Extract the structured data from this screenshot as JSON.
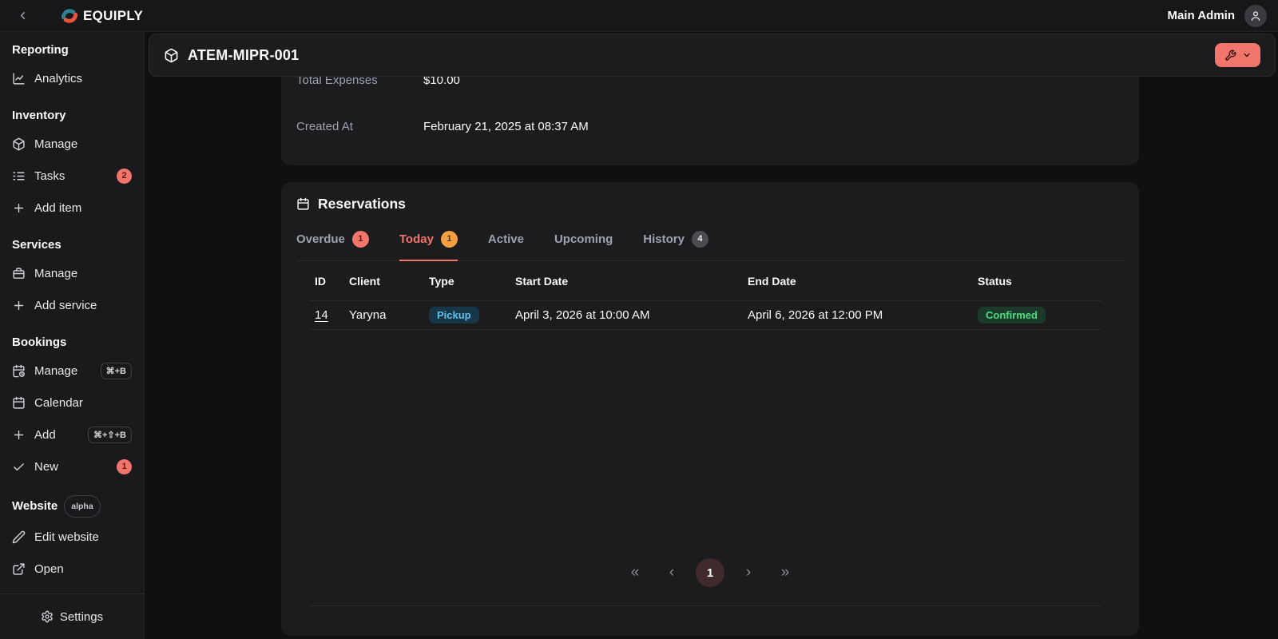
{
  "topbar": {
    "brand": "EQUIPLY",
    "user": "Main Admin"
  },
  "sidebar": {
    "sections": [
      {
        "heading": "Reporting",
        "items": [
          {
            "label": "Analytics",
            "icon": "analytics-icon"
          }
        ]
      },
      {
        "heading": "Inventory",
        "items": [
          {
            "label": "Manage",
            "icon": "cube-icon"
          },
          {
            "label": "Tasks",
            "icon": "tasks-icon",
            "badge": "2"
          },
          {
            "label": "Add item",
            "icon": "plus-icon"
          }
        ]
      },
      {
        "heading": "Services",
        "items": [
          {
            "label": "Manage",
            "icon": "briefcase-icon"
          },
          {
            "label": "Add service",
            "icon": "plus-icon"
          }
        ]
      },
      {
        "heading": "Bookings",
        "items": [
          {
            "label": "Manage",
            "icon": "calendar-clock-icon",
            "kbd": "⌘+B"
          },
          {
            "label": "Calendar",
            "icon": "calendar-icon"
          },
          {
            "label": "Add",
            "icon": "plus-icon",
            "kbd": "⌘+⇧+B"
          },
          {
            "label": "New",
            "icon": "check-icon",
            "badge": "1"
          }
        ]
      },
      {
        "heading": "Website",
        "heading_badge": "alpha",
        "items": [
          {
            "label": "Edit website",
            "icon": "pencil-icon"
          },
          {
            "label": "Open",
            "icon": "external-link-icon"
          }
        ]
      }
    ],
    "footer": {
      "settings_label": "Settings"
    }
  },
  "page": {
    "title": "ATEM-MIPR-001",
    "details": [
      {
        "label": "Total Expenses",
        "value": "$10.00"
      },
      {
        "label": "Created At",
        "value": "February 21, 2025 at 08:37 AM"
      }
    ],
    "reservations": {
      "title": "Reservations",
      "tabs": [
        {
          "label": "Overdue",
          "badge": "1"
        },
        {
          "label": "Today",
          "badge": "1",
          "active": true
        },
        {
          "label": "Active"
        },
        {
          "label": "Upcoming"
        },
        {
          "label": "History",
          "badge": "4"
        }
      ],
      "table": {
        "columns": [
          "ID",
          "Client",
          "Type",
          "Start Date",
          "End Date",
          "Status"
        ],
        "rows": [
          {
            "id": "14",
            "client": "Yaryna",
            "type": "Pickup",
            "start": "April 3, 2026 at 10:00 AM",
            "end": "April 6, 2026 at 12:00 PM",
            "status": "Confirmed"
          }
        ]
      },
      "pagination": {
        "current_page": "1",
        "first_glyph": "«",
        "prev_glyph": "‹",
        "next_glyph": "›",
        "last_glyph": "»"
      }
    }
  },
  "colors": {
    "accent_salmon": "#f2756b",
    "badge_orange": "#f59f43",
    "badge_gray": "#4b4b52",
    "type_badge_bg": "#173647",
    "type_badge_text": "#5ec1ec",
    "status_badge_bg": "#1c3a29",
    "status_badge_text": "#4ade80",
    "logo_teal": "#2f7f95",
    "logo_red": "#e8543c",
    "card_bg": "#1c1c1f",
    "page_bg": "#101013"
  }
}
